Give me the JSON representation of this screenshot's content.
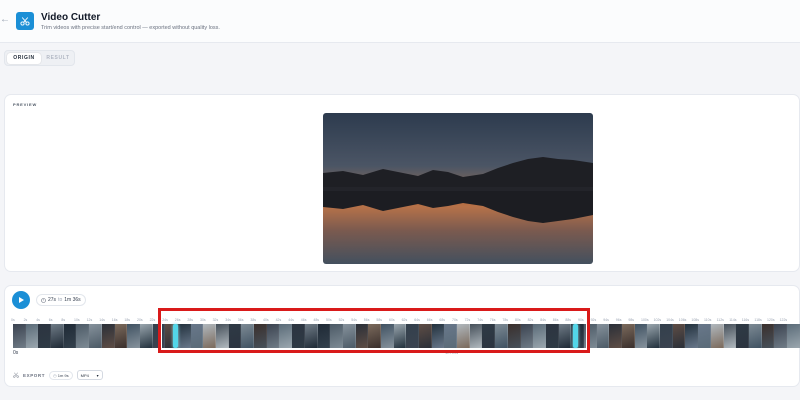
{
  "header": {
    "title": "Video Cutter",
    "subtitle": "Trim videos with precise start/end control — exported without quality loss.",
    "back_icon": "arrow-left-icon",
    "logo_icon": "scissors-icon",
    "accent": "#1b8fd6"
  },
  "tabs": [
    {
      "label": "ORIGIN",
      "active": true
    },
    {
      "label": "RESULT",
      "active": false
    }
  ],
  "preview": {
    "label": "PREVIEW"
  },
  "player": {
    "play_icon": "play-icon",
    "range_start": "27s",
    "range_separator": "to",
    "range_end": "1m 36s",
    "clock_icon": "clock-icon"
  },
  "timeline": {
    "tick_labels": [
      "0s",
      "2s",
      "4s",
      "6s",
      "8s",
      "10s",
      "12s",
      "14s",
      "16s",
      "18s",
      "20s",
      "22s",
      "24s",
      "26s",
      "28s",
      "30s",
      "32s",
      "34s",
      "36s",
      "38s",
      "40s",
      "42s",
      "44s",
      "46s",
      "48s",
      "50s",
      "52s",
      "54s",
      "56s",
      "58s",
      "60s",
      "62s",
      "64s",
      "66s",
      "68s",
      "70s",
      "72s",
      "74s",
      "76s",
      "78s",
      "80s",
      "82s",
      "84s",
      "86s",
      "88s",
      "90s",
      "92s",
      "94s",
      "96s",
      "98s",
      "100s",
      "102s",
      "104s",
      "106s",
      "108s",
      "110s",
      "112s",
      "114s",
      "116s",
      "118s",
      "120s",
      "122s"
    ],
    "start_label": "0s",
    "selection_duration": "1m 09s",
    "handle_color": "#53d6e8",
    "highlight_color": "#d91a1a"
  },
  "export": {
    "label": "EXPORT",
    "export_icon": "scissors-icon",
    "duration": "1m 9s",
    "format": "MP4",
    "format_options": [
      "MP4"
    ]
  }
}
